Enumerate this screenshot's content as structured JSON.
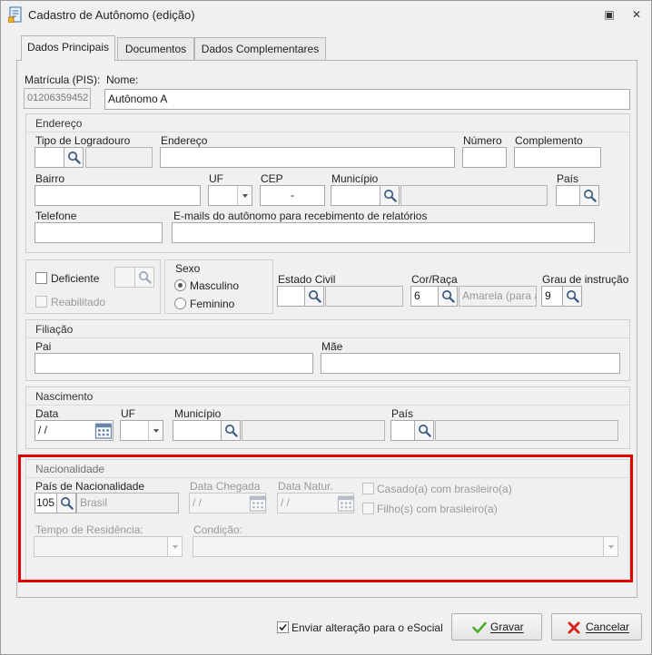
{
  "window": {
    "title": "Cadastro de Autônomo (edição)",
    "restore_glyph": "▣",
    "close_glyph": "✕"
  },
  "tabs": [
    {
      "label": "Dados Principais",
      "active": true
    },
    {
      "label": "Documentos",
      "active": false
    },
    {
      "label": "Dados Complementares",
      "active": false
    }
  ],
  "top": {
    "matricula_label": "Matrícula (PIS):",
    "matricula_value": "01206359452",
    "nome_label": "Nome:",
    "nome_value": "Autônomo A"
  },
  "endereco": {
    "title": "Endereço",
    "tipo_logradouro_label": "Tipo de Logradouro",
    "endereco_label": "Endereço",
    "numero_label": "Número",
    "complemento_label": "Complemento",
    "bairro_label": "Bairro",
    "uf_label": "UF",
    "cep_label": "CEP",
    "cep_value": "-",
    "municipio_label": "Município",
    "pais_label": "País",
    "telefone_label": "Telefone",
    "emails_label": "E-mails do autônomo para recebimento de relatórios"
  },
  "deficiente": {
    "deficiente_label": "Deficiente",
    "reabilitado_label": "Reabilitado"
  },
  "sexo": {
    "title": "Sexo",
    "masculino_label": "Masculino",
    "feminino_label": "Feminino",
    "selected": "Masculino"
  },
  "estado_civil": {
    "label": "Estado Civil"
  },
  "cor_raca": {
    "label": "Cor/Raça",
    "code": "6",
    "description": "Amarela (para a"
  },
  "grau_instrucao": {
    "label": "Grau de instrução",
    "code": "9"
  },
  "filiacao": {
    "title": "Filiação",
    "pai_label": "Pai",
    "mae_label": "Mãe"
  },
  "nascimento": {
    "title": "Nascimento",
    "data_label": "Data",
    "data_value": " / /",
    "uf_label": "UF",
    "municipio_label": "Município",
    "pais_label": "País"
  },
  "nacionalidade": {
    "title": "Nacionalidade",
    "pais_label": "País de Nacionalidade",
    "pais_code": "105",
    "pais_name": "Brasil",
    "data_chegada_label": "Data Chegada",
    "data_chegada_value": " / /",
    "data_natur_label": "Data Natur.",
    "data_natur_value": " / /",
    "casado_label": "Casado(a) com brasileiro(a)",
    "filhos_label": "Filho(s) com brasileiro(a)",
    "tempo_residencia_label": "Tempo de Residência:",
    "condicao_label": "Condição:"
  },
  "footer": {
    "esocial_label": "Enviar alteração para o eSocial",
    "esocial_checked": true,
    "gravar_label": "Gravar",
    "cancelar_label": "Cancelar"
  },
  "colors": {
    "highlight": "#e00000",
    "check_green": "#4caa2a",
    "cancel_red": "#d9261c"
  }
}
